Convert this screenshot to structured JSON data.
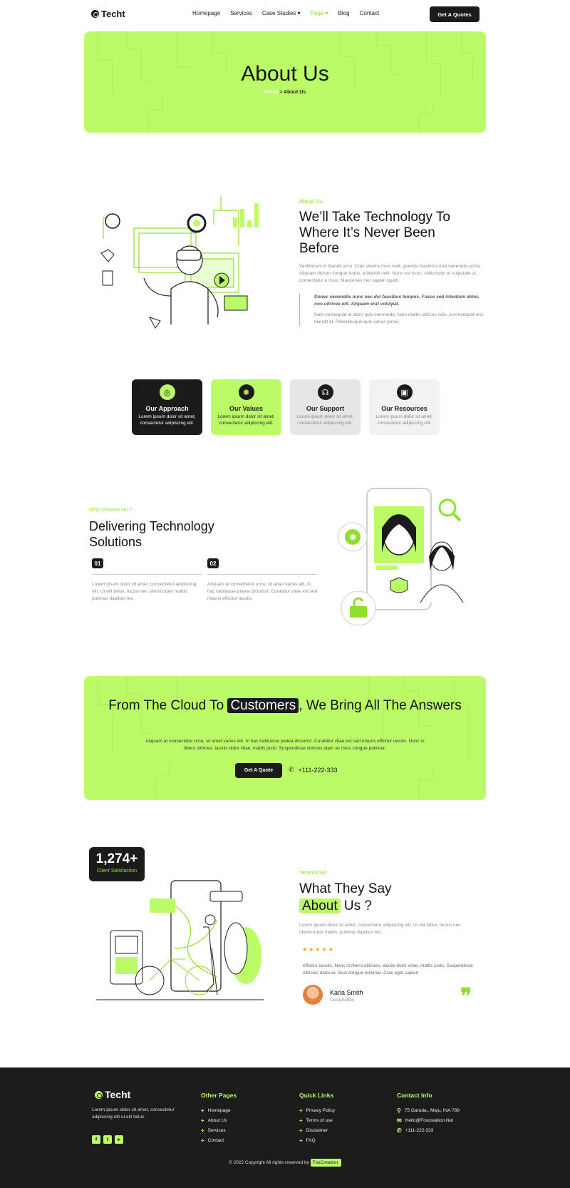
{
  "nav": {
    "logo": "Techt",
    "items": [
      {
        "label": "Homepage",
        "active": false
      },
      {
        "label": "Services",
        "active": false
      },
      {
        "label": "Case Studies ▾",
        "active": false
      },
      {
        "label": "Page ▾",
        "active": true
      },
      {
        "label": "Blog",
        "active": false
      },
      {
        "label": "Contact",
        "active": false
      }
    ],
    "cta": "Get A Quotes"
  },
  "hero": {
    "title": "About Us",
    "crumb_home": "Home",
    "crumb_sep": " > ",
    "crumb_current": "About Us"
  },
  "about": {
    "label": "About Us",
    "title": "We’ll Take Technology To Where It’s Never Been Before",
    "p1": "Vestibulum in blandit arcu. Cras viverra risus velit, gravida maximus erat venenatis porta. Aliquam dictum congue turpis, a blandit velit. Nunc est risus, sollicitudin et vulputate ut, consectetur a risus. Maecenas nec sapien quam.",
    "quote": "Donec venenatis nunc nec dui faucibus tempus. Fusce sed interdum dolor, non ultrices elit. Aliquam erat volutpat.",
    "p2": "Nam consequat id dolor quis commodo. Nam mattis ultrices odio, a consequat orci blandit at. Pellentesque quis varius purus."
  },
  "cards": [
    {
      "title": "Our Approach",
      "desc": "Lorem ipsum dolor sit amet, consectetur adipiscing elit.",
      "icon": "target-icon"
    },
    {
      "title": "Our Values",
      "desc": "Lorem ipsum dolor sit amet, consectetur adipiscing elit.",
      "icon": "lightbulb-icon"
    },
    {
      "title": "Our Support",
      "desc": "Lorem ipsum dolor sit amet, consectetur adipiscing elit.",
      "icon": "headset-icon"
    },
    {
      "title": "Our Resources",
      "desc": "Lorem ipsum dolor sit amet, consectetur adipiscing elit.",
      "icon": "monitor-icon"
    }
  ],
  "why": {
    "label": "Why Choose Us ?",
    "title": "Delivering Technology Solutions",
    "items": [
      {
        "num": "01",
        "text": "Lorem ipsum dolor sit amet, consectetur adipiscing elit. Ut elit tellus, luctus nec ullamcorper mattis, pulvinar dapibus leo."
      },
      {
        "num": "02",
        "text": "Aliquam at consectetur urna, sit amet varius elit. In hac habitasse platea dictumst. Curabitur vitae est sed mauris efficitur iaculis."
      }
    ]
  },
  "cta": {
    "title_pre": "From The Cloud To ",
    "title_hl": "Customers",
    "title_post": ", We Bring All The Answers",
    "text": "Aliquam at consectetur urna, sit amet varius elit. In hac habitasse platea dictumst. Curabitur vitae est sed mauris efficitur iaculis. Nunc in libero ultricies, iaculis dolor vitae, mattis justo. Suspendisse ultricies diam ac risus congue pulvinar.",
    "button": "Get A Quote",
    "phone": "+111-222-333"
  },
  "testimonial": {
    "stat_number": "1,274+",
    "stat_label": "Client Satisfaction",
    "label": "Testimonial",
    "title_pre": "What They Say ",
    "title_hl": "About",
    "title_post": " Us ?",
    "intro": "Lorem ipsum dolor sit amet, consectetur adipiscing elit. Ut elit tellus, luctus nec ullamcorper mattis, pulvinar dapibus leo.",
    "stars": "★★★★★",
    "rating": 5,
    "quote": "efficitur iaculis. Nunc in libero ultricies, iaculis dolor vitae, mattis justo. Suspendisse ultricies diam ac risus congue pulvinar. Cras eget sapien",
    "name": "Karla Smith",
    "role": "Designation"
  },
  "footer": {
    "logo": "Techt",
    "desc": "Lorem ipsum dolor sit amet, consectetur adipiscing elit ut elit tellus.",
    "socials": [
      "facebook-icon",
      "twitter-icon",
      "youtube-icon"
    ],
    "col1": {
      "title": "Other Pages",
      "items": [
        "Homepage",
        "About Us",
        "Services",
        "Contact"
      ]
    },
    "col2": {
      "title": "Quick Links",
      "items": [
        "Privacy Policy",
        "Terms of use",
        "Disclaimer",
        "FAQ"
      ]
    },
    "col3": {
      "title": "Contact Info",
      "items": [
        "75 Garuda., Maju, INA 789",
        "Hello@Foxcreation.Net",
        "+111-222-333"
      ]
    },
    "copyright": "© 2022 Copyright All rights reserved by",
    "brand": "FoxCreation."
  },
  "colors": {
    "accent": "#bcfb68",
    "accent_text": "#8ee02e",
    "dark": "#1b1b1b"
  }
}
